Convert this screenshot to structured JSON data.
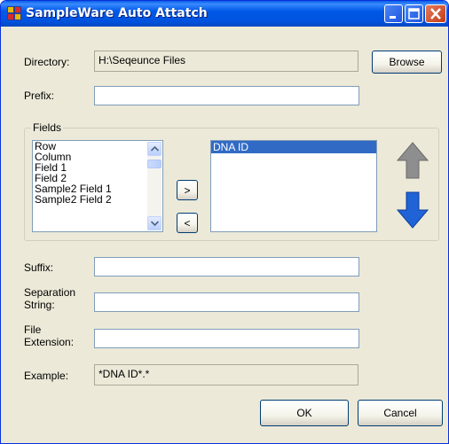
{
  "window": {
    "title": "SampleWare Auto Attatch",
    "colors": {
      "titlebar": "#0054e3",
      "face": "#ece9d8",
      "selection": "#316ac5"
    }
  },
  "directory": {
    "label": "Directory:",
    "value": "H:\\Seqeunce Files",
    "browse_label": "Browse"
  },
  "prefix": {
    "label": "Prefix:",
    "value": ""
  },
  "fields": {
    "group_label": "Fields",
    "available": [
      "Row",
      "Column",
      "Field 1",
      "Field 2",
      "Sample2 Field 1",
      "Sample2 Field 2"
    ],
    "selected": [
      "DNA ID"
    ],
    "add_label": ">",
    "remove_label": "<"
  },
  "suffix": {
    "label": "Suffix:",
    "value": ""
  },
  "separation": {
    "label_line1": "Separation",
    "label_line2": "String:",
    "value": ""
  },
  "extension": {
    "label_line1": "File",
    "label_line2": "Extension:",
    "value": ""
  },
  "example": {
    "label": "Example:",
    "value": "*DNA ID*.*"
  },
  "buttons": {
    "ok": "OK",
    "cancel": "Cancel"
  },
  "icons": [
    "app-icon",
    "minimize-icon",
    "maximize-icon",
    "close-icon",
    "arrow-up-icon",
    "arrow-down-icon"
  ]
}
